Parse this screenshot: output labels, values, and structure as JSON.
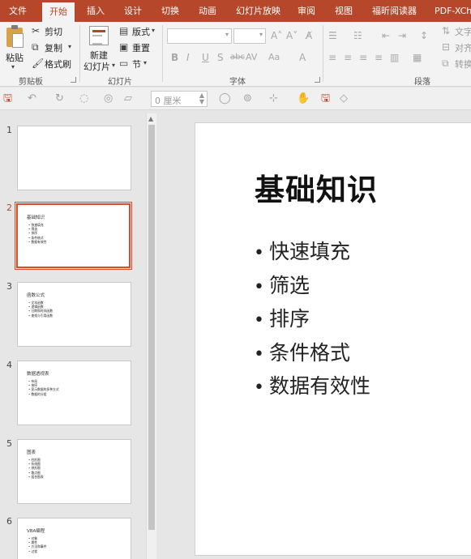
{
  "tabs": [
    "文件",
    "开始",
    "插入",
    "设计",
    "切换",
    "动画",
    "幻灯片放映",
    "审阅",
    "视图",
    "福昕阅读器",
    "PDF-XCha"
  ],
  "active_tab": "开始",
  "ribbon": {
    "clipboard": {
      "paste": "粘贴",
      "cut": "剪切",
      "copy": "复制",
      "format_painter": "格式刷",
      "group": "剪贴板"
    },
    "slides": {
      "new_slide": "新建",
      "new_slide_2": "幻灯片",
      "layout": "版式",
      "reset": "重置",
      "section": "节",
      "group": "幻灯片"
    },
    "font": {
      "group": "字体"
    },
    "paragraph": {
      "text_direction": "文字",
      "align_text": "对齐",
      "convert": "转换",
      "group": "段落"
    }
  },
  "quick_access": {
    "spin_value": "0 厘米"
  },
  "thumbnails": [
    {
      "num": "1",
      "title": "",
      "items": []
    },
    {
      "num": "2",
      "title": "基础知识",
      "items": [
        "快速填充",
        "筛选",
        "排序",
        "条件格式",
        "数据有效性"
      ]
    },
    {
      "num": "3",
      "title": "函数公式",
      "items": [
        "文本函数",
        "逻辑函数",
        "日期和时间函数",
        "查找与引用函数"
      ]
    },
    {
      "num": "4",
      "title": "数据透视表",
      "items": [
        "布局",
        "排序",
        "显示数据的多种方式",
        "数据的分组"
      ]
    },
    {
      "num": "5",
      "title": "图表",
      "items": [
        "柱形图",
        "折线图",
        "饼形图",
        "散点图",
        "组合图表"
      ]
    },
    {
      "num": "6",
      "title": "VBA编程",
      "items": [
        "对象",
        "属性",
        "方法和事件",
        "过程"
      ]
    }
  ],
  "current_slide": {
    "title": "基础知识",
    "bullets": [
      "快速填充",
      "筛选",
      "排序",
      "条件格式",
      "数据有效性"
    ]
  },
  "colors": {
    "accent": "#b7472a",
    "selection": "#d2502c"
  }
}
